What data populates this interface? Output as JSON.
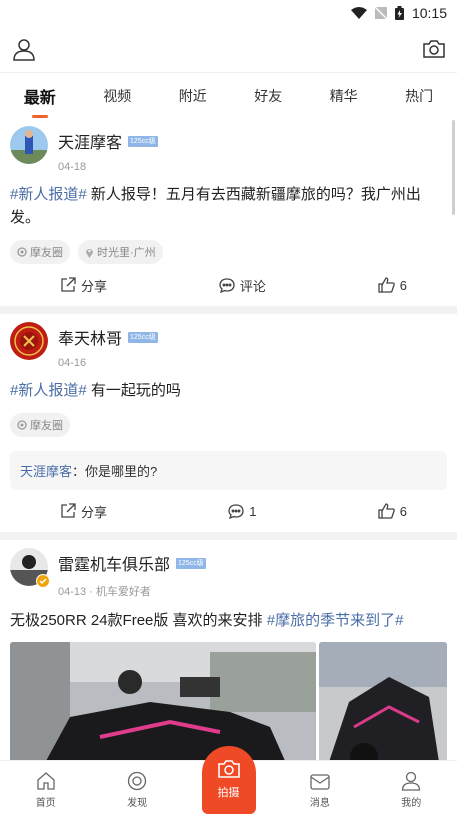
{
  "status_bar": {
    "time": "10:15"
  },
  "tabs": [
    "最新",
    "视频",
    "附近",
    "好友",
    "精华",
    "热门"
  ],
  "posts": [
    {
      "name": "天涯摩客",
      "badge": "125cc级",
      "date": "04-18",
      "hashtag": "#新人报道#",
      "text": " 新人报导！五月有去西藏新疆摩旅的吗？我广州出发。",
      "chips": [
        "摩友圈",
        "时光里·广州"
      ],
      "share": "分享",
      "comment": "评论",
      "likes": "6"
    },
    {
      "name": "奉天林哥",
      "badge": "125cc级",
      "date": "04-16",
      "hashtag": "#新人报道#",
      "text": " 有一起玩的吗",
      "chips": [
        "摩友圈"
      ],
      "comment_user": "天涯摩客",
      "comment_text": "：你是哪里的?",
      "share": "分享",
      "comment": "1",
      "likes": "6"
    },
    {
      "name": "雷霆机车俱乐部",
      "badge": "125cc级",
      "date": "04-13 · 机车爱好者",
      "text": "无极250RR 24款Free版 喜欢的来安排 ",
      "hashtag": "#摩旅的季节来到了#"
    }
  ],
  "bottom_nav": {
    "home": "首页",
    "discover": "发现",
    "capture": "拍摄",
    "messages": "消息",
    "mine": "我的"
  },
  "colors": {
    "accent": "#ef4a25",
    "hashtag": "#4a6da7"
  }
}
